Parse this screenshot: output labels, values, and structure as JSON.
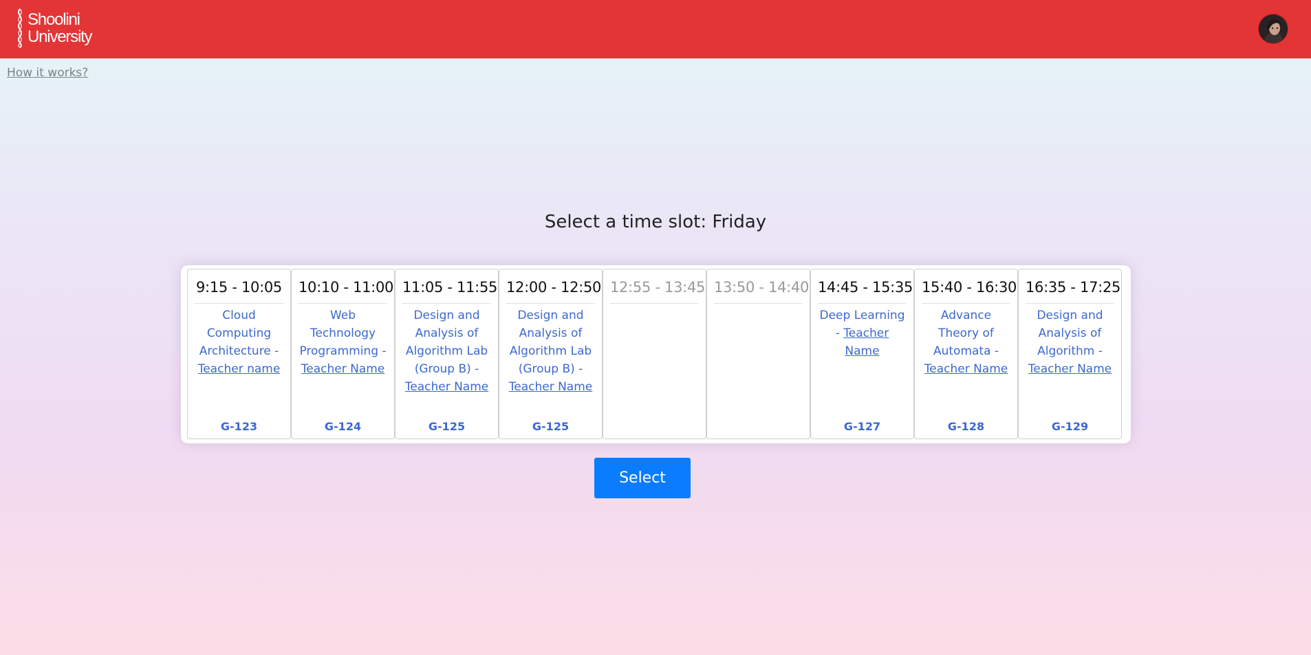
{
  "header": {
    "logo_line1": "Shoolini",
    "logo_line2": "University"
  },
  "help_link": "How it works?",
  "title": "Select a time slot: Friday",
  "slots": [
    {
      "time": "9:15 - 10:05",
      "course": "Cloud Computing Architecture - ",
      "teacher": "Teacher name",
      "room": "G-123"
    },
    {
      "time": "10:10 - 11:00",
      "course": "Web Technology Programming - ",
      "teacher": "Teacher Name",
      "room": "G-124"
    },
    {
      "time": "11:05 - 11:55",
      "course": "Design and Analysis of Algorithm Lab (Group B) - ",
      "teacher": "Teacher Name",
      "room": "G-125"
    },
    {
      "time": "12:00 - 12:50",
      "course": "Design and Analysis of Algorithm Lab (Group B) - ",
      "teacher": "Teacher Name",
      "room": "G-125"
    },
    {
      "time": "12:55 - 13:45"
    },
    {
      "time": "13:50 - 14:40"
    },
    {
      "time": "14:45 - 15:35",
      "course": "Deep Learning - ",
      "teacher": "Teacher Name",
      "room": "G-127"
    },
    {
      "time": "15:40 - 16:30",
      "course": "Advance Theory of Automata - ",
      "teacher": "Teacher Name",
      "room": "G-128"
    },
    {
      "time": "16:35 - 17:25",
      "course": "Design and Analysis of Algorithm - ",
      "teacher": "Teacher Name",
      "room": "G-129"
    }
  ],
  "select_label": "Select",
  "colors": {
    "header_bg": "#e33436",
    "link_blue": "#3c68cf",
    "button_bg": "#0a7cff"
  }
}
